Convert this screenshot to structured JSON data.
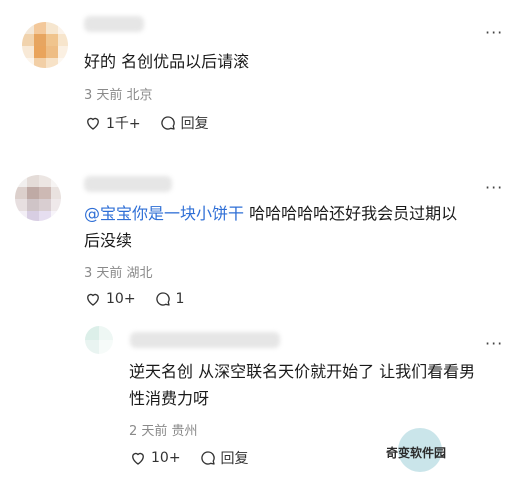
{
  "comments": [
    {
      "text_parts": [
        "好的 名创优品以后请滚"
      ],
      "meta": "3 天前 北京",
      "like_count": "1千+",
      "reply_label": "回复",
      "more_label": "···"
    },
    {
      "mention": "@宝宝你是一块小饼干",
      "line1_rest": " 哈哈哈哈哈还好我会员过期以",
      "line2": "后没续",
      "meta": "3 天前 湖北",
      "like_count": "10+",
      "reply_count": "1",
      "more_label": "···"
    },
    {
      "line1": "逆天名创 从深空联名天价就开始了 让我们看看男",
      "line2": "性消费力呀",
      "meta": "2 天前 贵州",
      "like_count": "10+",
      "reply_label": "回复",
      "more_label": "···"
    }
  ],
  "watermark": {
    "text": "奇变软件园"
  },
  "icons": {
    "like": "heart-icon",
    "reply": "speech-bubble-icon",
    "more": "more-dots-icon"
  }
}
